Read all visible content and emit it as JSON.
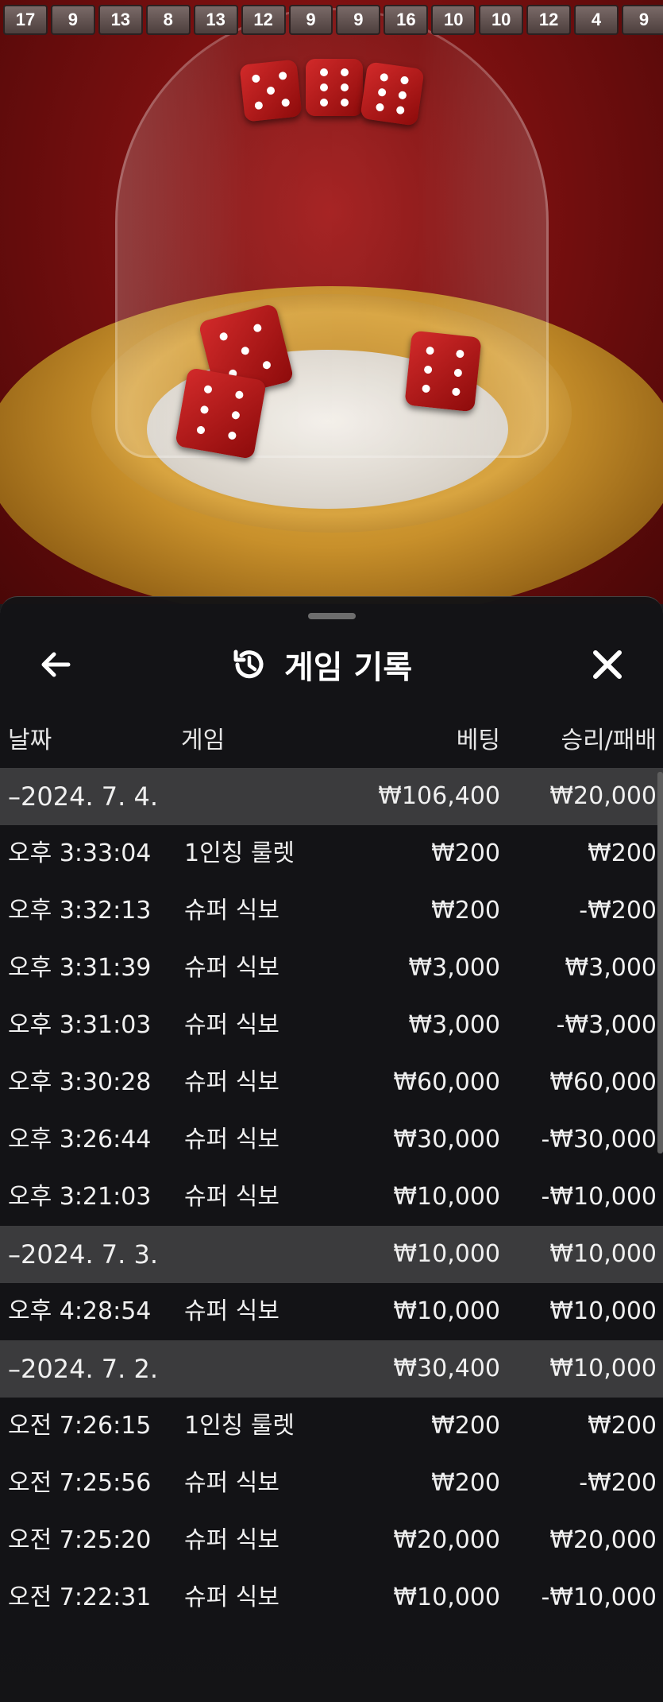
{
  "history_strip": [
    "17",
    "9",
    "13",
    "8",
    "13",
    "12",
    "9",
    "9",
    "16",
    "10",
    "10",
    "12",
    "4",
    "9"
  ],
  "sheet": {
    "title": "게임 기록",
    "columns": {
      "date": "날짜",
      "game": "게임",
      "bet": "베팅",
      "result": "승리/패배"
    },
    "icons": {
      "back": "arrow-left-icon",
      "history": "history-icon",
      "close": "close-icon"
    }
  },
  "groups": [
    {
      "date": "–2024. 7. 4.",
      "bet_total": "₩106,400",
      "result_total": "₩20,000",
      "rows": [
        {
          "time": "오후 3:33:04",
          "game": "1인칭 룰렛",
          "bet": "₩200",
          "result": "₩200"
        },
        {
          "time": "오후 3:32:13",
          "game": "슈퍼 식보",
          "bet": "₩200",
          "result": "-₩200"
        },
        {
          "time": "오후 3:31:39",
          "game": "슈퍼 식보",
          "bet": "₩3,000",
          "result": "₩3,000"
        },
        {
          "time": "오후 3:31:03",
          "game": "슈퍼 식보",
          "bet": "₩3,000",
          "result": "-₩3,000"
        },
        {
          "time": "오후 3:30:28",
          "game": "슈퍼 식보",
          "bet": "₩60,000",
          "result": "₩60,000"
        },
        {
          "time": "오후 3:26:44",
          "game": "슈퍼 식보",
          "bet": "₩30,000",
          "result": "-₩30,000"
        },
        {
          "time": "오후 3:21:03",
          "game": "슈퍼 식보",
          "bet": "₩10,000",
          "result": "-₩10,000"
        }
      ]
    },
    {
      "date": "–2024. 7. 3.",
      "bet_total": "₩10,000",
      "result_total": "₩10,000",
      "rows": [
        {
          "time": "오후 4:28:54",
          "game": "슈퍼 식보",
          "bet": "₩10,000",
          "result": "₩10,000"
        }
      ]
    },
    {
      "date": "–2024. 7. 2.",
      "bet_total": "₩30,400",
      "result_total": "₩10,000",
      "rows": [
        {
          "time": "오전 7:26:15",
          "game": "1인칭 룰렛",
          "bet": "₩200",
          "result": "₩200"
        },
        {
          "time": "오전 7:25:56",
          "game": "슈퍼 식보",
          "bet": "₩200",
          "result": "-₩200"
        },
        {
          "time": "오전 7:25:20",
          "game": "슈퍼 식보",
          "bet": "₩20,000",
          "result": "₩20,000"
        },
        {
          "time": "오전 7:22:31",
          "game": "슈퍼 식보",
          "bet": "₩10,000",
          "result": "-₩10,000"
        }
      ]
    }
  ]
}
